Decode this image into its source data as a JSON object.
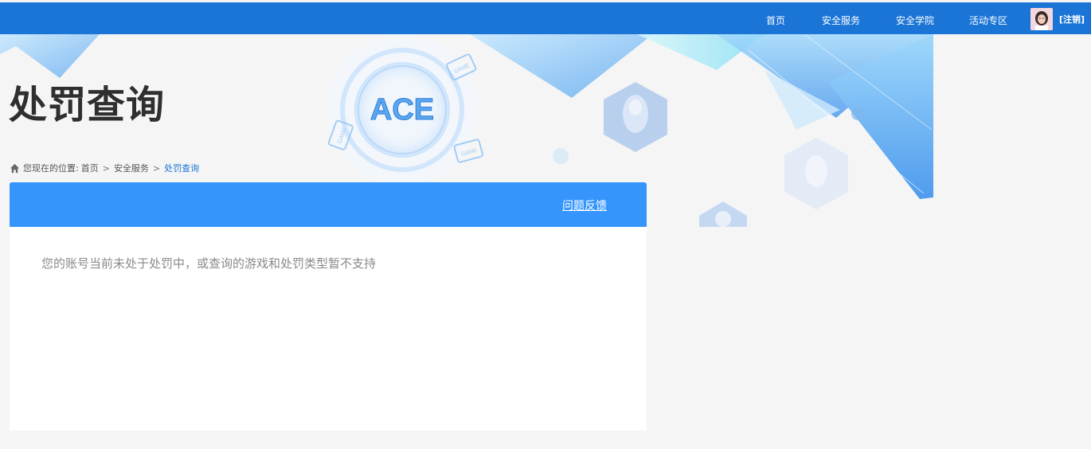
{
  "header": {
    "nav": [
      {
        "label": "首页"
      },
      {
        "label": "安全服务"
      },
      {
        "label": "安全学院"
      },
      {
        "label": "活动专区"
      }
    ],
    "logout_label": "[注销]"
  },
  "banner": {
    "logo_text": "ACE",
    "game_tag": "GAME"
  },
  "page": {
    "title": "处罚查询"
  },
  "breadcrumb": {
    "prefix": "您现在的位置:",
    "items": [
      "首页",
      "安全服务",
      "处罚查询"
    ],
    "separator": ">"
  },
  "panel": {
    "feedback_label": "问题反馈",
    "message": "您的账号当前未处于处罚中，或查询的游戏和处罚类型暂不支持"
  },
  "colors": {
    "topbar": "#1b75d7",
    "panel_header": "#3595fc",
    "page_bg": "#f5f5f5",
    "accent": "#1b75d7"
  }
}
